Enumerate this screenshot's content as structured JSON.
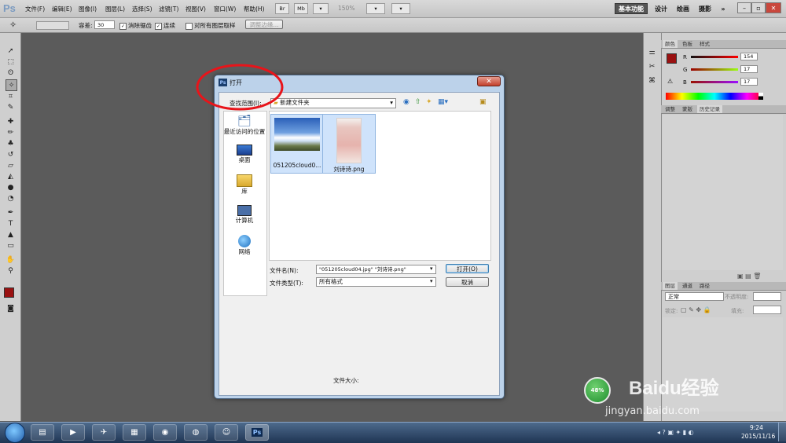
{
  "app": {
    "logo": "Ps",
    "menus": [
      "文件(F)",
      "编辑(E)",
      "图像(I)",
      "图层(L)",
      "选择(S)",
      "滤镜(T)",
      "视图(V)",
      "窗口(W)",
      "帮助(H)"
    ],
    "menubar_buttons": [
      "Br",
      "Mb"
    ],
    "zoom": "150%",
    "workspaces": {
      "active": "基本功能",
      "items": [
        "设计",
        "绘画",
        "摄影"
      ],
      "more": "»"
    }
  },
  "options_bar": {
    "tolerance_label": "容差:",
    "tolerance_value": "30",
    "antialias_label": "消除锯齿",
    "contiguous_label": "连续",
    "all_layers_label": "对所有图层取样",
    "refine_edge_label": "调整边缘..."
  },
  "color_panel": {
    "tabs": [
      "颜色",
      "色板",
      "样式"
    ],
    "channels": [
      {
        "name": "R",
        "value": "154"
      },
      {
        "name": "G",
        "value": "17"
      },
      {
        "name": "B",
        "value": "17"
      }
    ],
    "foreground_color": "#9a1111"
  },
  "adjust_panel": {
    "tabs": [
      "调整",
      "蒙版",
      "历史记录"
    ],
    "active": "历史记录"
  },
  "layers_panel": {
    "tabs": [
      "图层",
      "通道",
      "路径"
    ],
    "blend_mode": "正常",
    "opacity_label": "不透明度:",
    "lock_label": "锁定:",
    "fill_label": "填充:"
  },
  "dialog": {
    "title": "打开",
    "title_icon": "Ps",
    "look_in_label": "查找范围(I):",
    "current_folder": "新建文件夹",
    "places": [
      {
        "label": "最近访问的位置",
        "icon": "recent-places-icon"
      },
      {
        "label": "桌面",
        "icon": "desktop-icon"
      },
      {
        "label": "库",
        "icon": "library-icon"
      },
      {
        "label": "计算机",
        "icon": "computer-icon"
      },
      {
        "label": "网络",
        "icon": "network-icon"
      }
    ],
    "files": [
      {
        "name": "051205cloud0...",
        "icon": "sky-thumbnail-icon"
      },
      {
        "name": "刘诗诗.png",
        "icon": "person-thumbnail-icon"
      }
    ],
    "filename_label": "文件名(N):",
    "filename_value": "\"051205cloud04.jpg\" \"刘诗诗.png\"",
    "filetype_label": "文件类型(T):",
    "filetype_value": "所有格式",
    "open_button": "打开(O)",
    "cancel_button": "取消",
    "filesize_label": "文件大小:"
  },
  "taskbar": {
    "clock_time": "9:24",
    "clock_date": "2015/11/16",
    "ps_label": "Ps"
  },
  "watermark": {
    "percent": "48%",
    "brand": "Baidu经验",
    "url": "jingyan.baidu.com"
  },
  "colors": {
    "highlight_circle": "#e8141a",
    "dialog_border": "#49637f",
    "taskbar": "#1f3553"
  }
}
